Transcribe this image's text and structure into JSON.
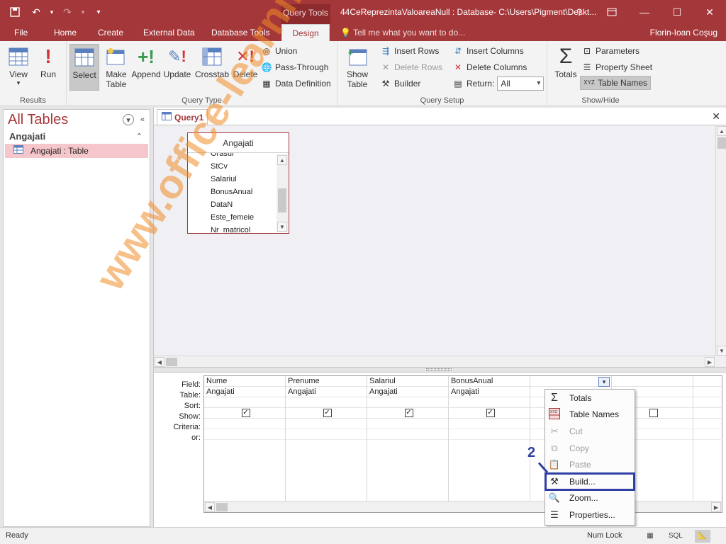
{
  "titlebar": {
    "context_tab": "Query Tools",
    "doc_title": "44CeReprezintaValoareaNull : Database- C:\\Users\\Pigment\\Deskt...",
    "help": "?"
  },
  "tabs": [
    "File",
    "Home",
    "Create",
    "External Data",
    "Database Tools",
    "Design"
  ],
  "active_tab": "Design",
  "tell_me": "Tell me what you want to do...",
  "user": "Florin-Ioan Coşug",
  "ribbon": {
    "results": {
      "label": "Results",
      "view": "View",
      "run": "Run"
    },
    "query_type": {
      "label": "Query Type",
      "select": "Select",
      "make_table_1": "Make",
      "make_table_2": "Table",
      "append": "Append",
      "update": "Update",
      "crosstab": "Crosstab",
      "delete": "Delete",
      "union": "Union",
      "pass_through": "Pass-Through",
      "data_definition": "Data Definition"
    },
    "query_setup": {
      "label": "Query Setup",
      "show_table_1": "Show",
      "show_table_2": "Table",
      "insert_rows": "Insert Rows",
      "delete_rows": "Delete Rows",
      "builder": "Builder",
      "insert_columns": "Insert Columns",
      "delete_columns": "Delete Columns",
      "return_label": "Return:",
      "return_value": "All"
    },
    "show_hide": {
      "label": "Show/Hide",
      "totals": "Totals",
      "parameters": "Parameters",
      "property_sheet": "Property Sheet",
      "table_names": "Table Names"
    }
  },
  "nav": {
    "title": "All Tables",
    "group": "Angajati",
    "item": "Angajati : Table"
  },
  "query_tab": "Query1",
  "table_box": {
    "title": "Angajati",
    "fields": [
      "Orasul",
      "StCv",
      "Salariul",
      "BonusAnual",
      "DataN",
      "Este_femeie",
      "Nr_matricol"
    ]
  },
  "grid": {
    "row_labels": [
      "Field:",
      "Table:",
      "Sort:",
      "Show:",
      "Criteria:",
      "or:"
    ],
    "columns": [
      {
        "field": "Nume",
        "table": "Angajati",
        "show": true
      },
      {
        "field": "Prenume",
        "table": "Angajati",
        "show": true
      },
      {
        "field": "Salariul",
        "table": "Angajati",
        "show": true
      },
      {
        "field": "BonusAnual",
        "table": "Angajati",
        "show": true
      },
      {
        "field": "",
        "table": "",
        "show": false
      },
      {
        "field": "",
        "table": "",
        "show": false
      }
    ]
  },
  "context_menu": {
    "items": [
      "Totals",
      "Table Names",
      "Cut",
      "Copy",
      "Paste",
      "Build...",
      "Zoom...",
      "Properties..."
    ]
  },
  "annotation": "2",
  "watermark": "www.office-learning.ro",
  "status": {
    "ready": "Ready",
    "num_lock": "Num Lock",
    "sql": "SQL"
  }
}
